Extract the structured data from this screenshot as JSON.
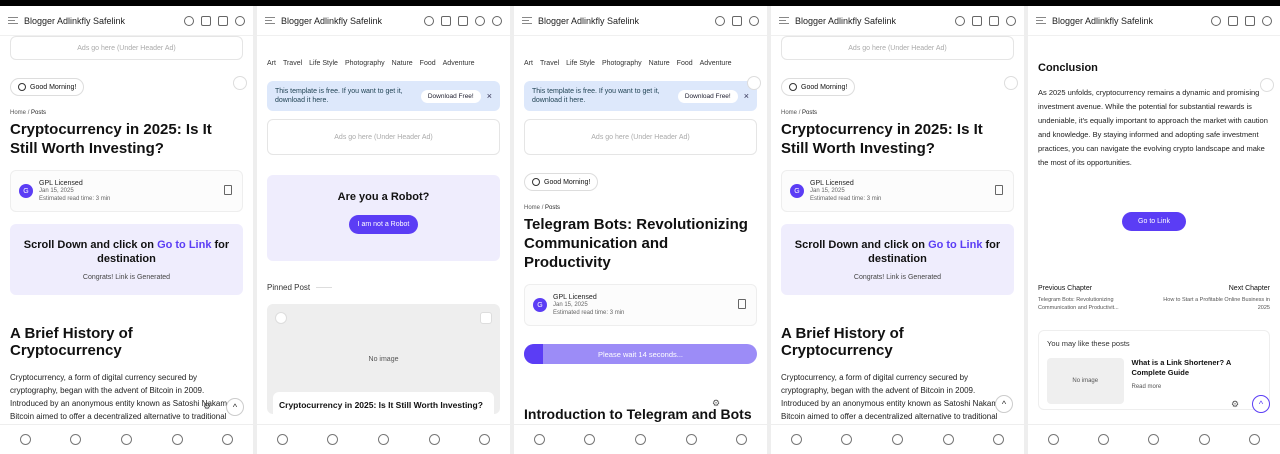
{
  "app_title": "Blogger Adlinkfly Safelink",
  "ad_text": "Ads go here (Under Header Ad)",
  "greeting": "Good Morning!",
  "breadcrumb": {
    "home": "Home",
    "sep": "/",
    "current": "Posts"
  },
  "post1": {
    "title": "Cryptocurrency in 2025: Is It Still Worth Investing?",
    "author_initial": "G",
    "author": "GPL Licensed",
    "date": "Jan 15, 2025",
    "read_time": "Estimated read time: 3 min",
    "scroll_text": "Scroll Down and click on",
    "go_link": "Go to Link",
    "scroll_suffix": "for destination",
    "congrats": "Congrats! Link is Generated",
    "h2": "A Brief History of Cryptocurrency",
    "body": "Cryptocurrency, a form of digital currency secured by cryptography, began with the advent of Bitcoin in 2009. Introduced by an anonymous entity known as Satoshi Nakamoto, Bitcoin aimed to offer a decentralized alternative to traditional"
  },
  "categories": [
    "Art",
    "Travel",
    "Life Style",
    "Photography",
    "Nature",
    "Food",
    "Adventure"
  ],
  "notice": {
    "text": "This template is free. If you want to get it, download it here.",
    "button": "Download Free!",
    "close": "×"
  },
  "robot": {
    "title": "Are you a Robot?",
    "button": "I am not a Robot"
  },
  "pinned": {
    "label": "Pinned Post",
    "no_image": "No image",
    "caption": "Cryptocurrency in 2025: Is It Still Worth Investing?"
  },
  "post2": {
    "title": "Telegram Bots: Revolutionizing Communication and Productivity",
    "wait_text": "Please wait 14 seconds...",
    "wait_progress": 0.08,
    "h2": "Introduction to Telegram and Bots Features"
  },
  "conclusion": {
    "title": "Conclusion",
    "body": "As 2025 unfolds, cryptocurrency remains a dynamic and promising investment avenue. While the potential for substantial rewards is undeniable, it's equally important to approach the market with caution and knowledge. By staying informed and adopting safe investment practices, you can navigate the evolving crypto landscape and make the most of its opportunities.",
    "go_button": "Go to Link",
    "prev_label": "Previous Chapter",
    "prev_title": "Telegram Bots: Revolutionizing Communication and Productivit...",
    "next_label": "Next Chapter",
    "next_title": "How to Start a Profitable Online Business in 2025",
    "like_header": "You may like these posts",
    "like_no_image": "No image",
    "like_post_title": "What is a Link Shortener? A Complete Guide",
    "like_read_more": "Read more"
  },
  "accent_color": "#5b3df5"
}
